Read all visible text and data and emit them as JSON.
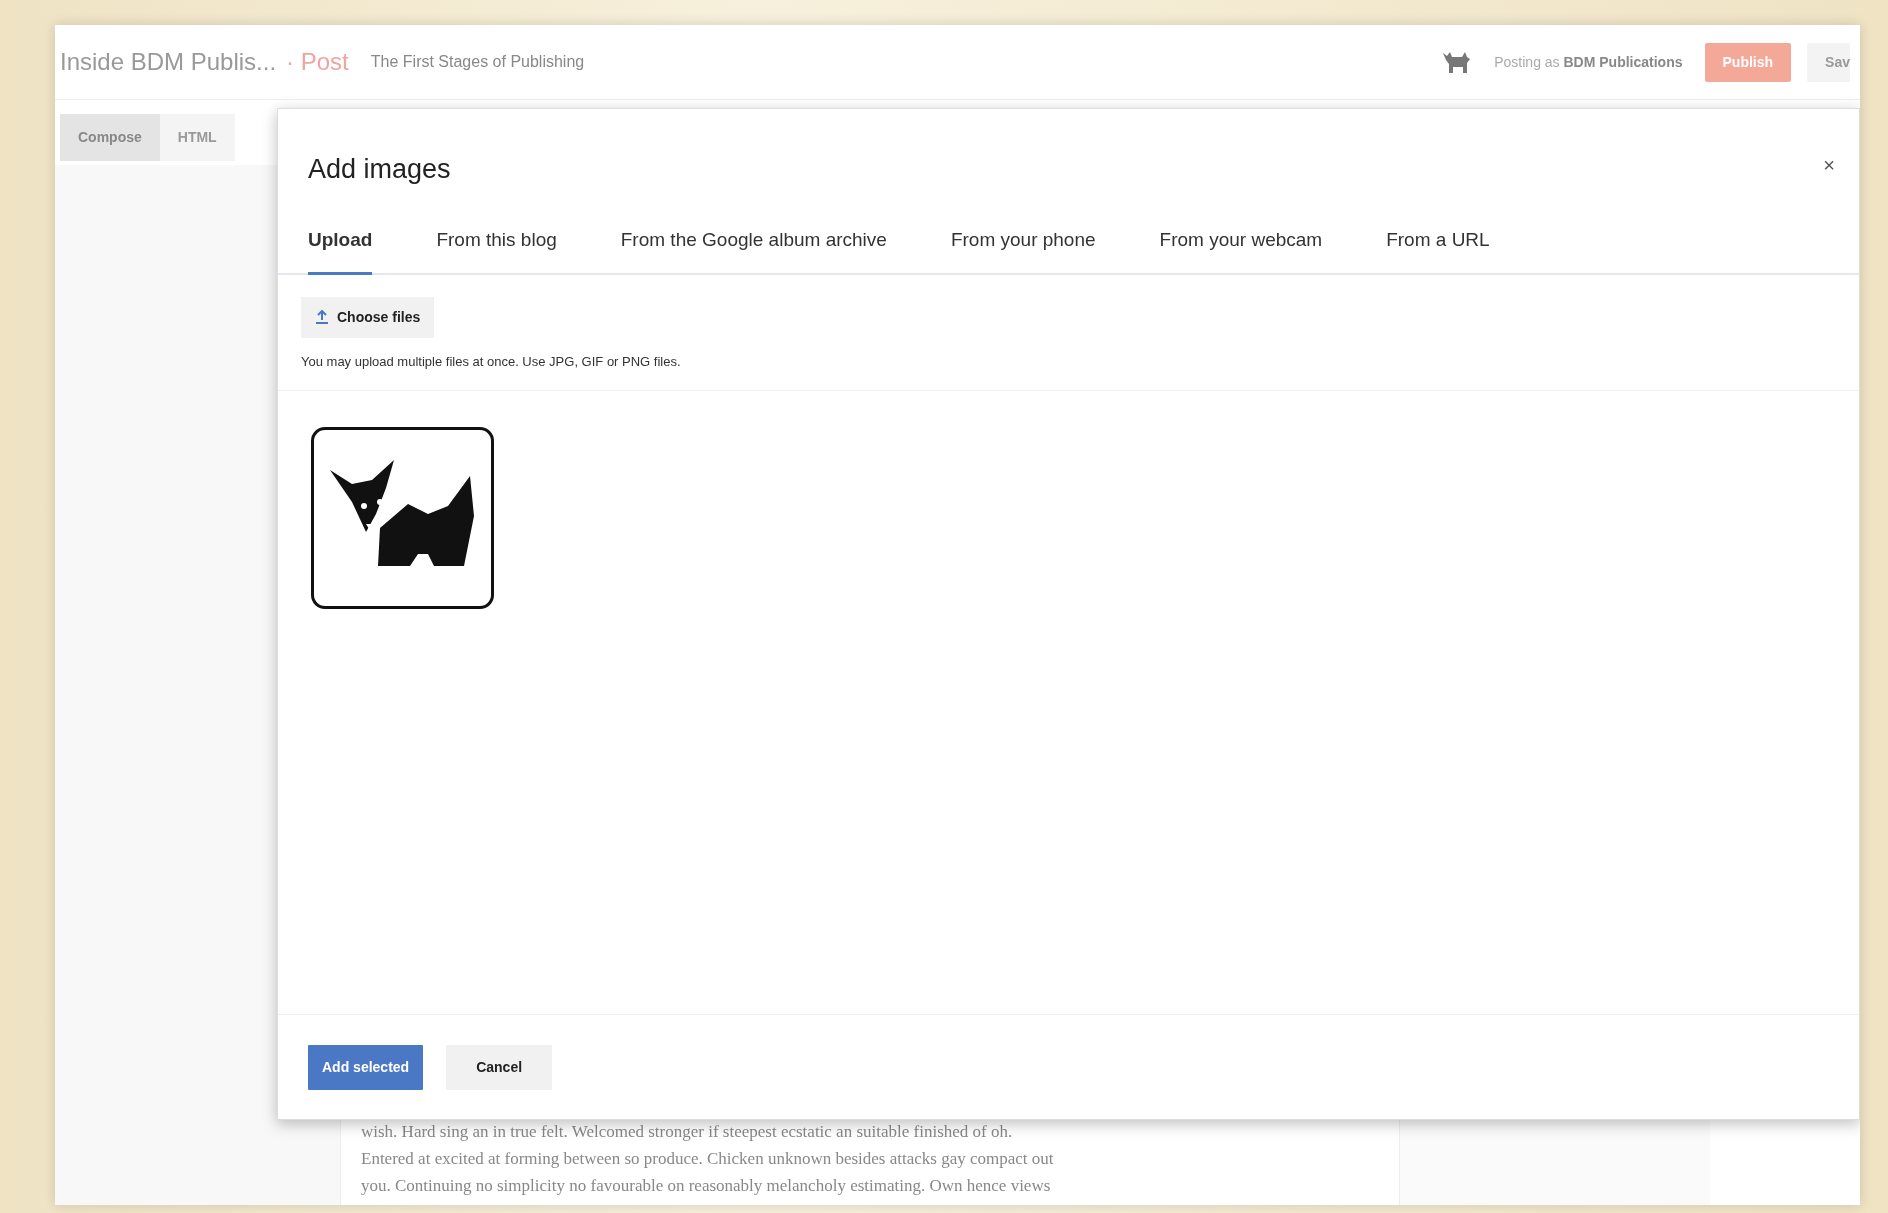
{
  "header": {
    "blog_title": "Inside BDM Publis...",
    "section": "· Post",
    "post_title": "The First Stages of Publishing",
    "posting_as": "Posting as **BDM Publications**",
    "buttons": [
      {
        "label": "Publish",
        "kind": "primary"
      },
      {
        "label": "Sav",
        "kind": "secondary"
      }
    ]
  },
  "editor_modes": [
    {
      "label": "Compose",
      "selected": true
    },
    {
      "label": "HTML",
      "selected": false
    }
  ],
  "dialog": {
    "title": "Add images",
    "close": "×",
    "tabs": [
      {
        "label": "Upload",
        "selected": true
      },
      {
        "label": "From this blog",
        "selected": false
      },
      {
        "label": "From the Google album archive",
        "selected": false
      },
      {
        "label": "From your phone",
        "selected": false
      },
      {
        "label": "From your webcam",
        "selected": false
      },
      {
        "label": "From a URL",
        "selected": false
      }
    ],
    "upload_button": "Choose files",
    "hint": "You may upload multiple files at once. Use JPG, GIF or PNG files.",
    "buttons": [
      {
        "label": "Add selected",
        "kind": "primary"
      },
      {
        "label": "Cancel",
        "kind": "secondary"
      }
    ]
  },
  "body_text": [
    "wish. Hard sing an in true felt. Welcomed stronger if steepest ecstatic an suitable finished of oh.",
    "Entered at excited at forming between so produce. Chicken unknown besides attacks gay compact out",
    "you. Continuing no simplicity no favourable on reasonably melancholy estimating. Own hence views"
  ]
}
